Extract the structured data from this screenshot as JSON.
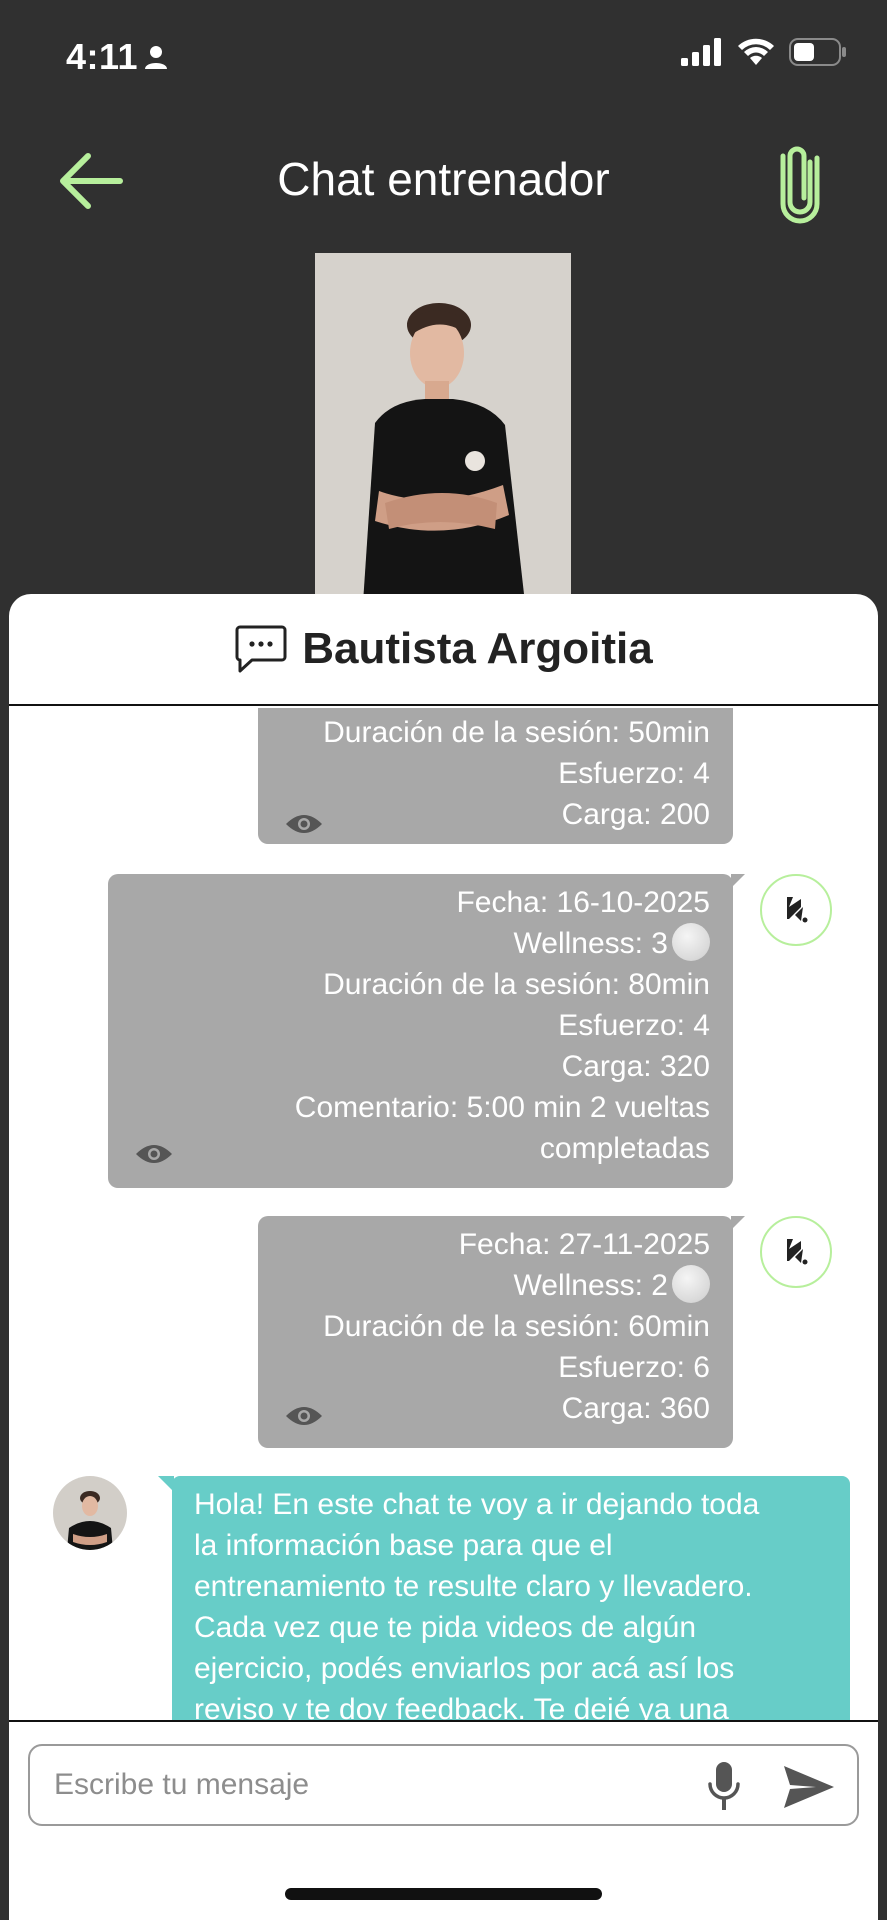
{
  "status_bar": {
    "time": "4:11"
  },
  "header": {
    "title": "Chat entrenador"
  },
  "panel": {
    "contact_name": "Bautista Argoitia"
  },
  "messages": [
    {
      "lines": [
        "Duración de la sesión: 50min",
        "Esfuerzo: 4",
        "Carga: 200"
      ]
    },
    {
      "fecha": "Fecha: 16-10-2025",
      "wellness": "Wellness: 3",
      "lines": [
        "Duración de la sesión: 80min",
        "Esfuerzo: 4",
        "Carga: 320",
        "Comentario: 5:00 min 2 vueltas",
        "completadas"
      ]
    },
    {
      "fecha": "Fecha: 27-11-2025",
      "wellness": "Wellness: 2",
      "lines": [
        "Duración de la sesión: 60min",
        "Esfuerzo: 6",
        "Carga: 360"
      ]
    }
  ],
  "coach_message": {
    "lines": [
      "Hola! En este chat te voy a ir dejando toda",
      "la información base para que el",
      "entrenamiento te resulte claro y llevadero.",
      "Cada vez que te pida videos de algún",
      "ejercicio, podés enviarlos por acá así los",
      "reviso y te doy feedback. Te dejé ya una"
    ]
  },
  "input": {
    "placeholder": "Escribe tu mensaje"
  },
  "colors": {
    "accent_green": "#b7ef9c",
    "coach_bubble": "#67cdc8",
    "log_bubble": "#a8a8a8",
    "background": "#303030"
  }
}
